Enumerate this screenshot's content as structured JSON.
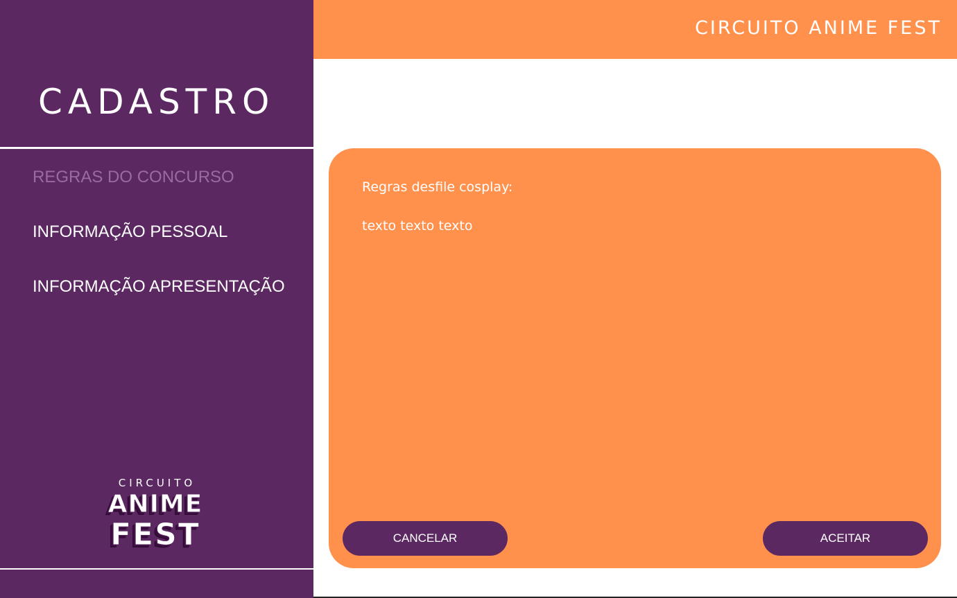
{
  "header": {
    "title": "CIRCUITO ANIME FEST"
  },
  "sidebar": {
    "title": "CADASTRO",
    "items": [
      {
        "label": "REGRAS DO CONCURSO",
        "active": true
      },
      {
        "label": "INFORMAÇÃO PESSOAL",
        "active": false
      },
      {
        "label": "INFORMAÇÃO APRESENTAÇÃO",
        "active": false
      }
    ],
    "logo": {
      "line1": "CIRCUITO",
      "line2": "ANIME",
      "line3": "FEST"
    }
  },
  "panel": {
    "heading": "Regras desfile cosplay:",
    "body": "texto texto texto",
    "cancel_label": "CANCELAR",
    "accept_label": "ACEITAR"
  },
  "colors": {
    "purple": "#5b2862",
    "orange": "#ff914d",
    "inactive_nav": "#9b6aa0"
  }
}
